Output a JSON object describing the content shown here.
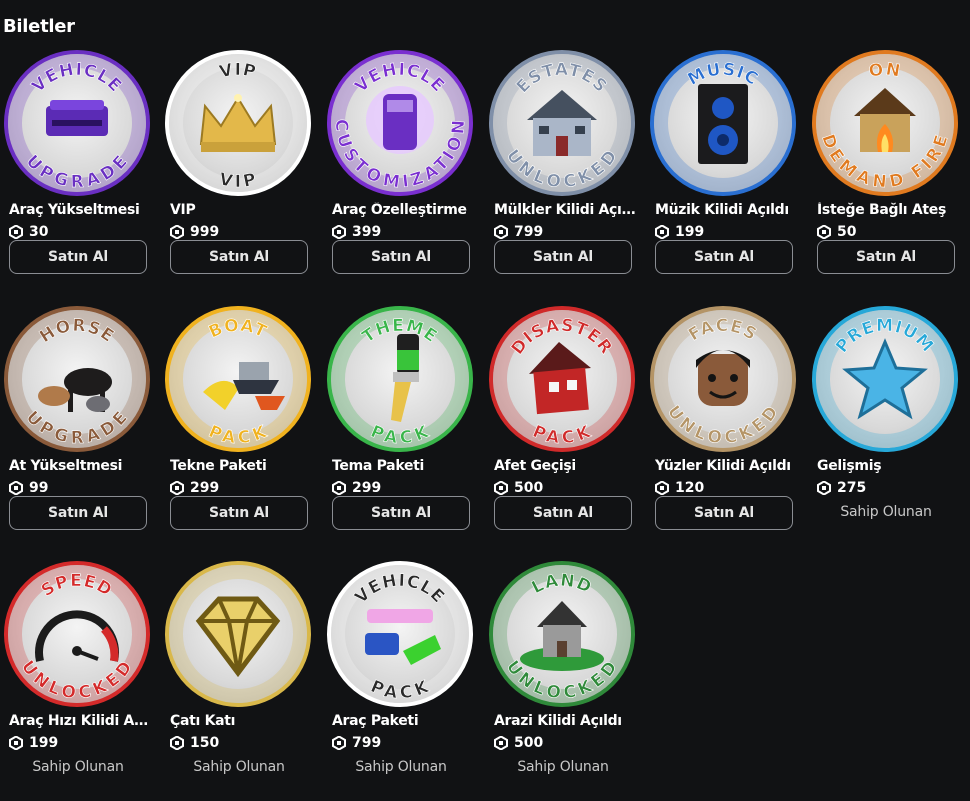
{
  "section_title": "Biletler",
  "buy_label": "Satın Al",
  "owned_label": "Sahip Olunan",
  "items": [
    {
      "name": "Araç Yükseltmesi",
      "price": "30",
      "owned": false,
      "badge_top": "VEHICLE",
      "badge_bottom": "UPGRADE",
      "ring_color": "#6a2fc2",
      "icon": "purple-car-icon"
    },
    {
      "name": "VIP",
      "price": "999",
      "owned": false,
      "badge_top": "VIP",
      "badge_bottom": "VIP",
      "ring_color": "#ffffff",
      "icon": "crown-icon"
    },
    {
      "name": "Araç Özelleştirme",
      "price": "399",
      "owned": false,
      "badge_top": "VEHICLE",
      "badge_bottom": "CUSTOMIZATION",
      "ring_color": "#7a2fd0",
      "icon": "custom-car-icon"
    },
    {
      "name": "Mülkler Kilidi Açıldı",
      "price": "799",
      "owned": false,
      "badge_top": "ESTATES",
      "badge_bottom": "UNLOCKED",
      "ring_color": "#7f8fa8",
      "icon": "mansion-icon"
    },
    {
      "name": "Müzik Kilidi Açıldı",
      "price": "199",
      "owned": false,
      "badge_top": "MUSIC",
      "badge_bottom": "",
      "ring_color": "#2a6fd1",
      "icon": "speaker-icon"
    },
    {
      "name": "İsteğe Bağlı Ateş",
      "price": "50",
      "owned": false,
      "badge_top": "ON",
      "badge_bottom": "DEMAND FIRE",
      "ring_color": "#e07a1f",
      "icon": "burning-house-icon"
    },
    {
      "name": "At Yükseltmesi",
      "price": "99",
      "owned": false,
      "badge_top": "HORSE",
      "badge_bottom": "UPGRADE",
      "ring_color": "#8a5a3a",
      "icon": "horses-icon"
    },
    {
      "name": "Tekne Paketi",
      "price": "299",
      "owned": false,
      "badge_top": "BOAT",
      "badge_bottom": "PACK",
      "ring_color": "#f0b21f",
      "icon": "boats-icon"
    },
    {
      "name": "Tema Paketi",
      "price": "299",
      "owned": false,
      "badge_top": "THEME",
      "badge_bottom": "PACK",
      "ring_color": "#39b54a",
      "icon": "paintbrush-icon"
    },
    {
      "name": "Afet Geçişi",
      "price": "500",
      "owned": false,
      "badge_top": "DISASTER",
      "badge_bottom": "PACK",
      "ring_color": "#d02a2a",
      "icon": "disaster-house-icon"
    },
    {
      "name": "Yüzler Kilidi Açıldı",
      "price": "120",
      "owned": false,
      "badge_top": "FACES",
      "badge_bottom": "UNLOCKED",
      "ring_color": "#b49466",
      "icon": "face-icon"
    },
    {
      "name": "Gelişmiş",
      "price": "275",
      "owned": true,
      "badge_top": "PREMIUM",
      "badge_bottom": "",
      "ring_color": "#27a8d8",
      "icon": "star-icon"
    },
    {
      "name": "Araç Hızı Kilidi Aç...",
      "price": "199",
      "owned": true,
      "badge_top": "SPEED",
      "badge_bottom": "UNLOCKED",
      "ring_color": "#d42a2a",
      "icon": "speedometer-icon"
    },
    {
      "name": "Çatı Katı",
      "price": "150",
      "owned": true,
      "badge_top": "",
      "badge_bottom": "",
      "ring_color": "#d9b84a",
      "icon": "diamond-icon"
    },
    {
      "name": "Araç Paketi",
      "price": "799",
      "owned": true,
      "badge_top": "VEHICLE",
      "badge_bottom": "PACK",
      "ring_color": "#ffffff",
      "icon": "vehicles-icon"
    },
    {
      "name": "Arazi Kilidi Açıldı",
      "price": "500",
      "owned": true,
      "badge_top": "LAND",
      "badge_bottom": "UNLOCKED",
      "ring_color": "#2f8a3a",
      "icon": "land-house-icon"
    }
  ]
}
